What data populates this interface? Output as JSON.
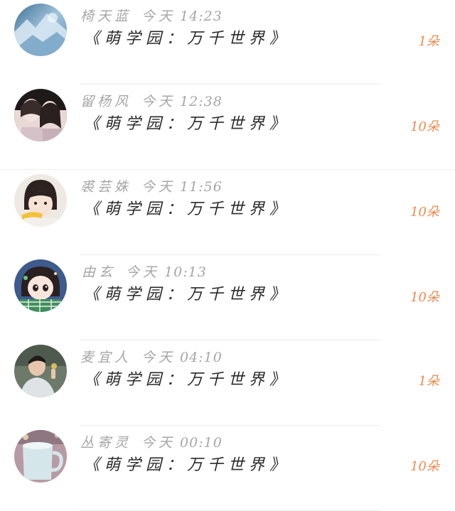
{
  "colors": {
    "name_time": "#a6a6a6",
    "title": "#2a2a2a",
    "amount": "#ee8a4e",
    "divider": "#ececec",
    "background": "#ffffff"
  },
  "gifts": [
    {
      "name": "椅天蓝",
      "day": "今天",
      "time": "14:23",
      "title": "《萌学园：万千世界》",
      "amount": "1朵",
      "avatar": "ice-landscape-avatar"
    },
    {
      "name": "留杨风",
      "day": "今天",
      "time": "12:38",
      "title": "《萌学园：万千世界》",
      "amount": "10朵",
      "avatar": "couple-photo-avatar"
    },
    {
      "name": "裘芸姝",
      "day": "今天",
      "time": "11:56",
      "title": "《萌学园：万千世界》",
      "amount": "10朵",
      "avatar": "child-photo-avatar"
    },
    {
      "name": "由玄",
      "day": "今天",
      "time": "10:13",
      "title": "《萌学园：万千世界》",
      "amount": "10朵",
      "avatar": "cartoon-girl-avatar"
    },
    {
      "name": "麦宜人",
      "day": "今天",
      "time": "04:10",
      "title": "《萌学园：万千世界》",
      "amount": "1朵",
      "avatar": "boy-photo-avatar"
    },
    {
      "name": "丛寄灵",
      "day": "今天",
      "time": "00:10",
      "title": "《萌学园：万千世界》",
      "amount": "10朵",
      "avatar": "mug-photo-avatar"
    }
  ]
}
